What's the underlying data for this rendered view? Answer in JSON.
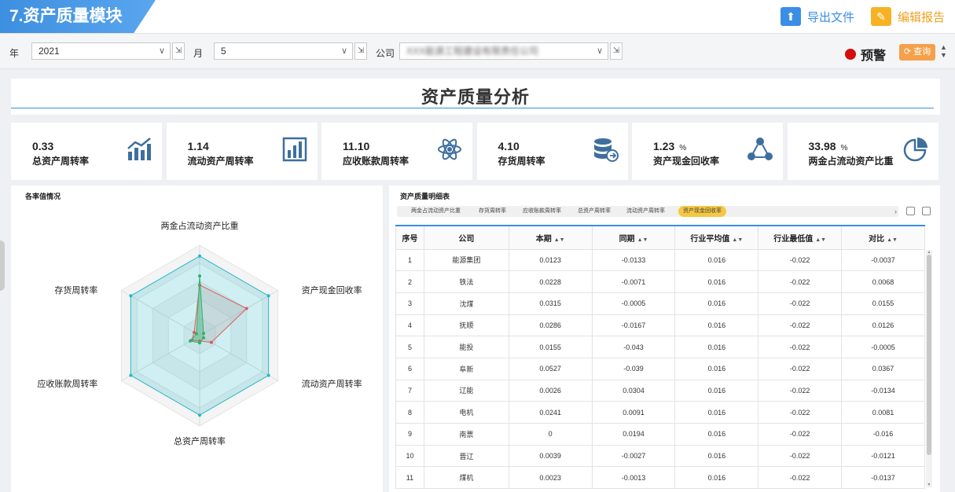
{
  "header": {
    "module_title": "7.资产质量模块",
    "export_label": "导出文件",
    "edit_label": "编辑报告"
  },
  "filters": {
    "year_label": "年",
    "year_value": "2021",
    "month_label": "月",
    "month_value": "5",
    "company_label": "公司",
    "company_value": "XXX能源工程建设有限责任公司",
    "warning_label": "预警",
    "query_label": "查询"
  },
  "page_title": "资产质量分析",
  "kpis": [
    {
      "value": "0.33",
      "unit": "",
      "label": "总资产周转率",
      "icon": "bar-chart-trend-icon"
    },
    {
      "value": "1.14",
      "unit": "",
      "label": "流动资产周转率",
      "icon": "bar-chart-icon"
    },
    {
      "value": "11.10",
      "unit": "",
      "label": "应收账款周转率",
      "icon": "atom-icon"
    },
    {
      "value": "4.10",
      "unit": "",
      "label": "存货周转率",
      "icon": "database-icon"
    },
    {
      "value": "1.23",
      "unit": "%",
      "label": "资产现金回收率",
      "icon": "network-icon"
    },
    {
      "value": "33.98",
      "unit": "%",
      "label": "两金占流动资产比重",
      "icon": "pie-chart-icon"
    }
  ],
  "radar": {
    "title": "各率值情况",
    "axes": [
      "两金占流动资产比重",
      "资产现金回收率",
      "流动资产周转率",
      "总资产周转率",
      "应收账款周转率",
      "存货周转率"
    ],
    "chart_data": {
      "type": "radar",
      "categories": [
        "两金占流动资产比重",
        "资产现金回收率",
        "流动资产周转率",
        "总资产周转率",
        "应收账款周转率",
        "存货周转率"
      ],
      "rmax": 1.0,
      "series": [
        {
          "name": "",
          "color": "#27b7c9",
          "values": [
            0.88,
            0.88,
            0.88,
            0.88,
            0.88,
            0.88
          ]
        },
        {
          "name": "",
          "color": "#e05a5a",
          "values": [
            0.56,
            0.6,
            0.15,
            0.06,
            0.1,
            0.07
          ]
        },
        {
          "name": "",
          "color": "#2db36b",
          "values": [
            0.66,
            0.05,
            0.05,
            0.08,
            0.12,
            0.04
          ]
        }
      ]
    }
  },
  "table": {
    "title": "资产质量明细表",
    "tabs": [
      "两金占流动资产比重",
      "存货周转率",
      "应收账款周转率",
      "总资产周转率",
      "流动资产周转率",
      "资产现金回收率"
    ],
    "active_tab": 5,
    "columns": [
      "序号",
      "公司",
      "本期",
      "同期",
      "行业平均值",
      "行业最低值",
      "对比"
    ],
    "rows": [
      [
        "1",
        "能源集团",
        "0.0123",
        "-0.0133",
        "0.016",
        "-0.022",
        "-0.0037"
      ],
      [
        "2",
        "铁法",
        "0.0228",
        "-0.0071",
        "0.016",
        "-0.022",
        "0.0068"
      ],
      [
        "3",
        "沈煤",
        "0.0315",
        "-0.0005",
        "0.016",
        "-0.022",
        "0.0155"
      ],
      [
        "4",
        "抚顺",
        "0.0286",
        "-0.0167",
        "0.016",
        "-0.022",
        "0.0126"
      ],
      [
        "5",
        "能投",
        "0.0155",
        "-0.043",
        "0.016",
        "-0.022",
        "-0.0005"
      ],
      [
        "6",
        "阜新",
        "0.0527",
        "-0.039",
        "0.016",
        "-0.022",
        "0.0367"
      ],
      [
        "7",
        "辽能",
        "0.0026",
        "0.0304",
        "0.016",
        "-0.022",
        "-0.0134"
      ],
      [
        "8",
        "电机",
        "0.0241",
        "0.0091",
        "0.016",
        "-0.022",
        "0.0081"
      ],
      [
        "9",
        "南票",
        "0",
        "0.0194",
        "0.016",
        "-0.022",
        "-0.016"
      ],
      [
        "10",
        "晋辽",
        "0.0039",
        "-0.0027",
        "0.016",
        "-0.022",
        "-0.0121"
      ],
      [
        "11",
        "煤机",
        "0.0023",
        "-0.0013",
        "0.016",
        "-0.022",
        "-0.0137"
      ]
    ]
  },
  "colors": {
    "accent": "#3a8ee6",
    "edit": "#f5b323",
    "warning": "#d40d0d",
    "query": "#f5a04a",
    "active_tab": "#f5c842"
  }
}
